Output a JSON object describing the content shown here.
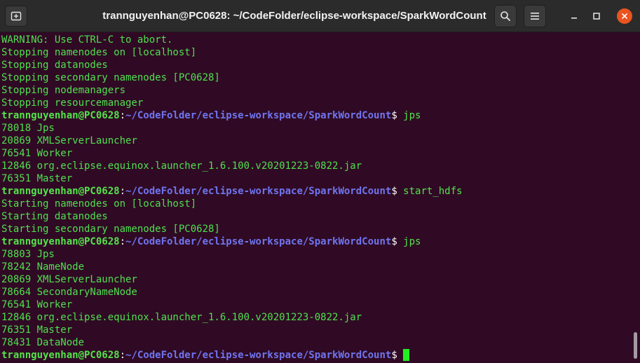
{
  "window": {
    "title": "trannguyenhan@PC0628: ~/CodeFolder/eclipse-workspace/SparkWordCount"
  },
  "prompt": {
    "user_host": "trannguyenhan@PC0628",
    "separator": ":",
    "path": "~/CodeFolder/eclipse-workspace/SparkWordCount",
    "dollar": "$"
  },
  "lines": [
    {
      "type": "out",
      "text": "WARNING: Use CTRL-C to abort."
    },
    {
      "type": "out",
      "text": "Stopping namenodes on [localhost]"
    },
    {
      "type": "out",
      "text": "Stopping datanodes"
    },
    {
      "type": "out",
      "text": "Stopping secondary namenodes [PC0628]"
    },
    {
      "type": "out",
      "text": "Stopping nodemanagers"
    },
    {
      "type": "out",
      "text": "Stopping resourcemanager"
    },
    {
      "type": "prompt",
      "cmd": " jps"
    },
    {
      "type": "out",
      "text": "78018 Jps"
    },
    {
      "type": "out",
      "text": "20869 XMLServerLauncher"
    },
    {
      "type": "out",
      "text": "76541 Worker"
    },
    {
      "type": "out",
      "text": "12846 org.eclipse.equinox.launcher_1.6.100.v20201223-0822.jar"
    },
    {
      "type": "out",
      "text": "76351 Master"
    },
    {
      "type": "prompt",
      "cmd": " start_hdfs"
    },
    {
      "type": "out",
      "text": "Starting namenodes on [localhost]"
    },
    {
      "type": "out",
      "text": "Starting datanodes"
    },
    {
      "type": "out",
      "text": "Starting secondary namenodes [PC0628]"
    },
    {
      "type": "prompt",
      "cmd": " jps"
    },
    {
      "type": "out",
      "text": "78803 Jps"
    },
    {
      "type": "out",
      "text": "78242 NameNode"
    },
    {
      "type": "out",
      "text": "20869 XMLServerLauncher"
    },
    {
      "type": "out",
      "text": "78664 SecondaryNameNode"
    },
    {
      "type": "out",
      "text": "76541 Worker"
    },
    {
      "type": "out",
      "text": "12846 org.eclipse.equinox.launcher_1.6.100.v20201223-0822.jar"
    },
    {
      "type": "out",
      "text": "76351 Master"
    },
    {
      "type": "out",
      "text": "78431 DataNode"
    },
    {
      "type": "prompt",
      "cmd": " ",
      "cursor": true
    }
  ],
  "colors": {
    "background": "#300a24",
    "output_text": "#4fe04f",
    "prompt_user": "#53e34a",
    "prompt_path": "#6f75f0",
    "cursor": "#22ee22",
    "close_button": "#e95420"
  },
  "icons": {
    "new_tab": "new-tab-icon",
    "search": "search-icon",
    "menu": "hamburger-menu-icon",
    "minimize": "minimize-icon",
    "maximize": "maximize-icon",
    "close": "close-icon"
  }
}
